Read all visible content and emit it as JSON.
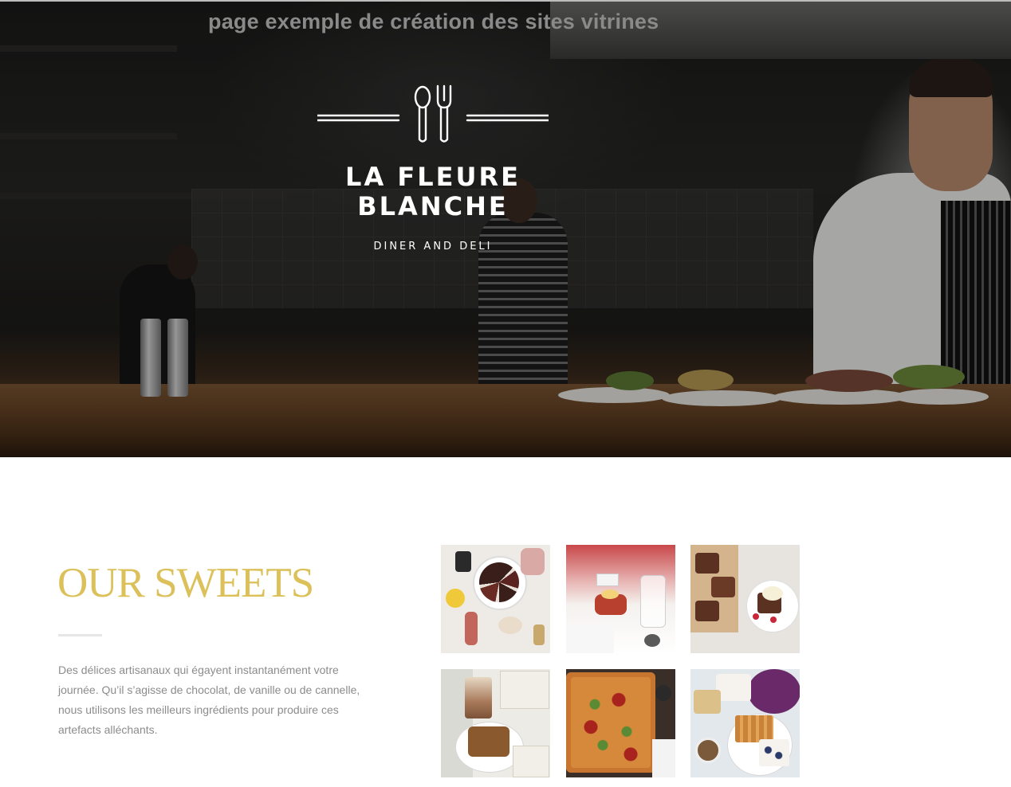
{
  "page": {
    "caption": "page exemple de création des sites vitrines"
  },
  "hero": {
    "brand_name": "LA FLEURE\nBLANCHE",
    "tagline": "DINER AND DELI",
    "logo_icon": "spoon-and-fork-icon"
  },
  "sweets": {
    "title": "OUR SWEETS",
    "description": "Des délices artisanaux qui égayent instantanément votre journée. Qu’il s’agisse de chocolat, de vanille ou de cannelle, nous utilisons les meilleurs ingrédients pour produire ces artefacts alléchants.",
    "gallery": [
      {
        "subject": "dessert-table-cake"
      },
      {
        "subject": "plated-dessert-with-glass"
      },
      {
        "subject": "brownies-with-ice-cream"
      },
      {
        "subject": "coffee-and-cake"
      },
      {
        "subject": "pizza-slices"
      },
      {
        "subject": "waffles-with-berries"
      }
    ]
  },
  "colors": {
    "accent_gold": "#dcc05a",
    "body_text": "#8c8c8c",
    "caption_gray": "#8a8a8a"
  }
}
